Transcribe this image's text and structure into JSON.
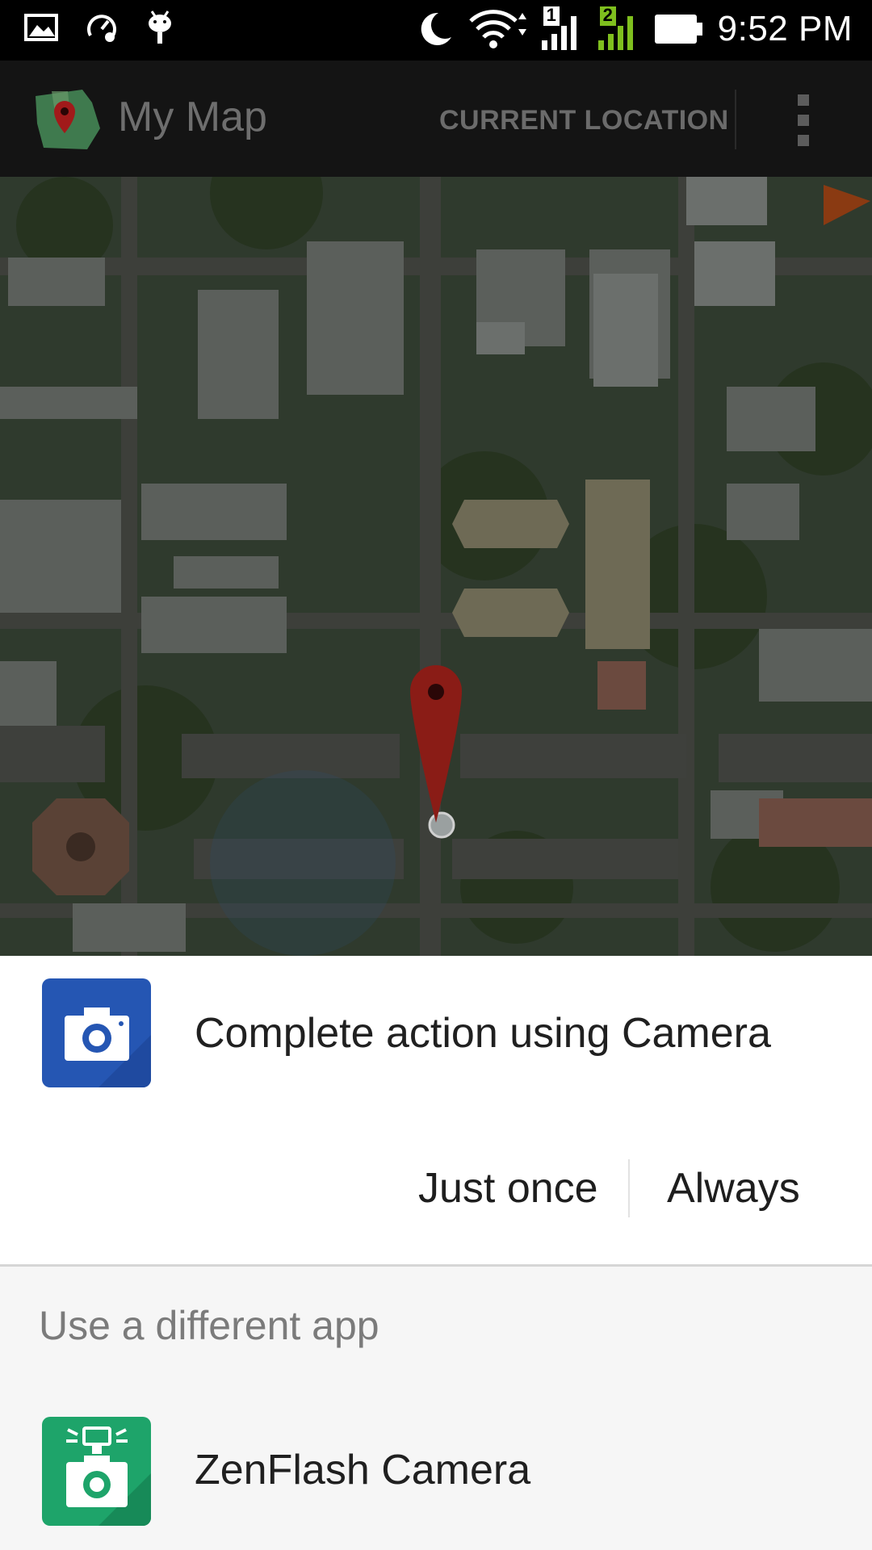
{
  "status_bar": {
    "time": "9:52 PM",
    "left_icons": [
      "image-icon",
      "speedometer-icon",
      "android-bug-icon"
    ],
    "right_icons": [
      "moon-icon",
      "wifi-icon",
      "signal-sim1-icon",
      "signal-sim2-icon",
      "battery-icon"
    ],
    "sim1_label": "1",
    "sim2_label": "2"
  },
  "app_bar": {
    "title": "My Map",
    "action_label": "CURRENT LOCATION",
    "overflow_icon": "more-vert-icon"
  },
  "dialog": {
    "prompt": "Complete action using Camera",
    "app_icon": "camera-icon",
    "app_color": "#2556b3",
    "just_once_label": "Just once",
    "always_label": "Always",
    "different_app_label": "Use a different app",
    "alt_app": {
      "name": "ZenFlash Camera",
      "icon": "zenflash-camera-icon",
      "color": "#1ea46a"
    }
  }
}
